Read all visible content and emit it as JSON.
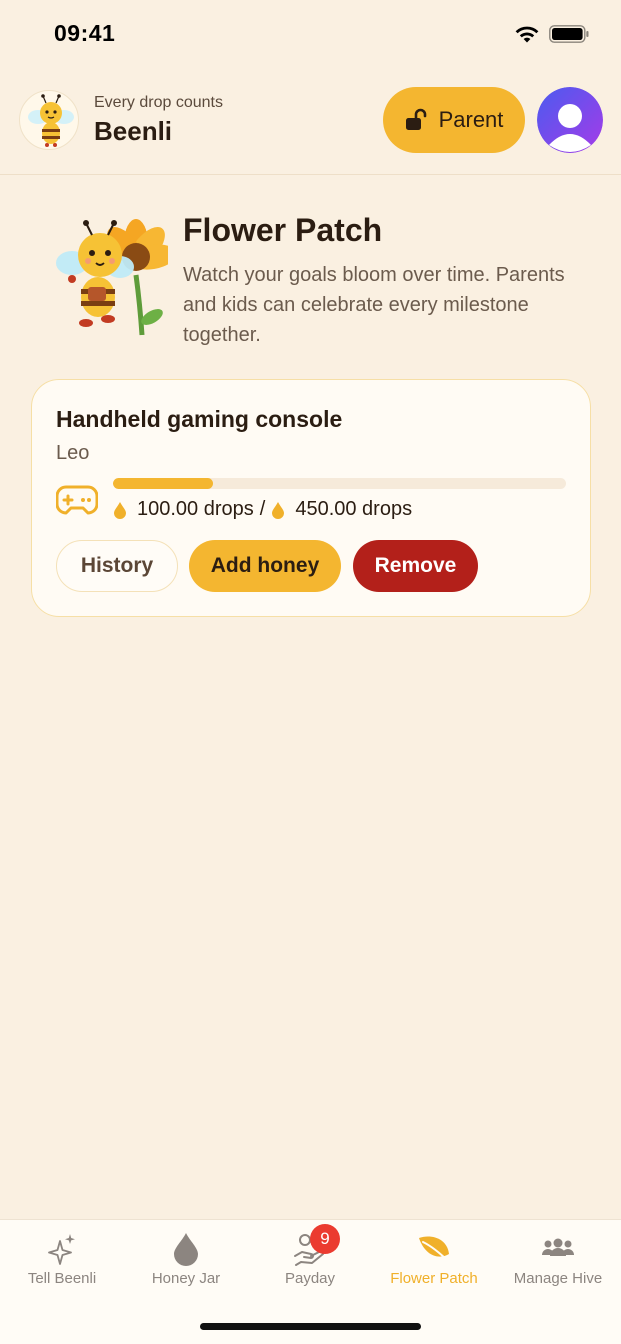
{
  "status_bar": {
    "time": "09:41"
  },
  "header": {
    "subtitle": "Every drop counts",
    "title": "Beenli",
    "parent_button_label": "Parent"
  },
  "hero": {
    "title": "Flower Patch",
    "description": "Watch your goals bloom over time. Parents and kids can celebrate every milestone together."
  },
  "goal_card": {
    "title": "Handheld gaming console",
    "owner": "Leo",
    "icon": "gamepad-icon",
    "progress": {
      "current": "100.00 drops",
      "separator": "/",
      "target": "450.00 drops",
      "fraction": 0.22
    },
    "buttons": {
      "history": "History",
      "add_honey": "Add honey",
      "remove": "Remove"
    }
  },
  "tabs": [
    {
      "label": "Tell Beenli",
      "icon": "sparkles-icon"
    },
    {
      "label": "Honey Jar",
      "icon": "drop-icon"
    },
    {
      "label": "Payday",
      "icon": "hand-coin-icon",
      "badge": "9"
    },
    {
      "label": "Flower Patch",
      "icon": "leaf-icon",
      "active": true
    },
    {
      "label": "Manage Hive",
      "icon": "people-icon"
    }
  ],
  "colors": {
    "background": "#FAF0E1",
    "accent": "#F4B630",
    "danger": "#B3201A",
    "badge": "#EB3B30",
    "text": "#2B1D12"
  }
}
